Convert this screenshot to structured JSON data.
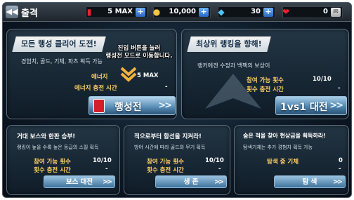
{
  "header": {
    "title": "출격",
    "fuel": "5 MAX",
    "coins": "10,000",
    "gems": "30",
    "hearts": "0"
  },
  "planet": {
    "banner": "모든 행성 클리어 도전!",
    "desc": "경험치, 골드, 기체, 파츠 획득 가능",
    "energy_label": "에너지",
    "energy_value": "5 MAX",
    "charge_label": "에너지 충전 시간",
    "charge_value": "-",
    "button": "행성전",
    "tooltip_line1": "진입 버튼을 눌러",
    "tooltip_line2": "행성전 모드로 이동합니다."
  },
  "pvp": {
    "banner": "최상위 랭킹을 향해!",
    "desc": "랭커에겐 수정과 백팩의 보상이",
    "attempts_label": "참여 가능 횟수",
    "attempts_value": "10/10",
    "charge_label": "횟수 충전 시간",
    "charge_value": "-",
    "button": "1vs1 대전"
  },
  "boss": {
    "title": "거대 보스와 한판 승부!",
    "desc": "랭킹이 높을 수록 높은 등급의 스킬 획득",
    "attempts_label": "참여 가능 횟수",
    "attempts_value": "10/10",
    "charge_label": "횟수 충전 시간",
    "charge_value": "-",
    "button": "보스 대전"
  },
  "survival": {
    "title": "적으로부터 함선을 지켜라!",
    "desc": "방어 시간에 따라 골드와 무기 획득",
    "attempts_label": "참여 가능 횟수",
    "attempts_value": "10/10",
    "charge_label": "횟수 충전 시간",
    "charge_value": "-",
    "button": "생 존"
  },
  "explore": {
    "title": "숨은 적을 찾아 현상금을 획득하라!",
    "desc": "탐색기체는 추가 경험치 획득 가능",
    "ship_label": "탐색 중 기체",
    "ship_value": "0",
    "charge_value": "-",
    "button": "탐 색"
  },
  "colors": {
    "accent": "#ffd166",
    "button_top": "#a7cde7",
    "button_bottom": "#2a5275",
    "banner_text": "#18324a"
  }
}
